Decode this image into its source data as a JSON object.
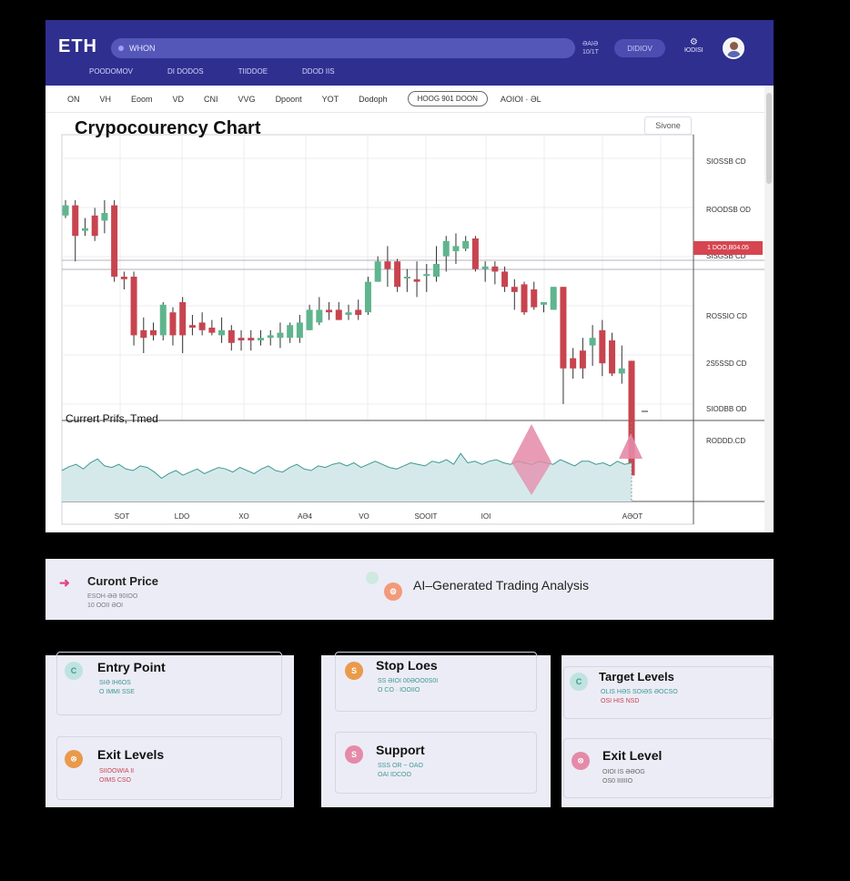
{
  "app": {
    "logo": "ETH",
    "search_text": "WHON",
    "top_meta": [
      "ƏAIƏ",
      "10/1T"
    ],
    "pill_label": "DIDIOV",
    "top_icon_label": "ЮDISI",
    "nav": [
      "POODOMOV",
      "DI DODOS",
      "TIIDDOE",
      "DDOD IIS"
    ]
  },
  "toolbar": {
    "timeframes": [
      "ON",
      "VH",
      "Eoom",
      "VD",
      "CNI",
      "VVG",
      "Dpoont",
      "YOT",
      "Dodoph"
    ],
    "range": "HOOG 901 DOON",
    "range_extra": "AOIOI · ƏL"
  },
  "chart": {
    "title": "Crypocourency Chart",
    "indicator_label": "Currert Prifs, Tmed",
    "legend": "Sivone",
    "price_tag": "1 DOO,B04.05",
    "price_axis": [
      "SIOSSB CD",
      "ROODSB OD",
      "SISGSB CD",
      "ROSSIO CD",
      "2S5SSD CD",
      "SIODBB OD",
      "RODDD.CD"
    ],
    "x_axis": [
      "SOT",
      "LDO",
      "XO",
      "AƏ4",
      "VO",
      "SOOIT",
      "IOI",
      "AƏOT"
    ],
    "colors": {
      "up": "#5fb58e",
      "down": "#c8444f",
      "area": "#d6e9ea",
      "area_line": "#3d9a92",
      "marker": "#e58aa8"
    }
  },
  "chart_data": {
    "type": "candlestick",
    "title": "Crypocourency Chart",
    "xlabel": "",
    "ylabel": "",
    "ylim": [
      0,
      100
    ],
    "candles": [
      {
        "o": 74,
        "c": 78,
        "h": 80,
        "l": 73
      },
      {
        "o": 78,
        "c": 66,
        "h": 80,
        "l": 56
      },
      {
        "o": 68,
        "c": 69,
        "h": 73,
        "l": 66
      },
      {
        "o": 74,
        "c": 66,
        "h": 77,
        "l": 64
      },
      {
        "o": 72,
        "c": 75,
        "h": 80,
        "l": 67
      },
      {
        "o": 78,
        "c": 50,
        "h": 80,
        "l": 48
      },
      {
        "o": 50,
        "c": 49,
        "h": 52,
        "l": 45
      },
      {
        "o": 50,
        "c": 27,
        "h": 52,
        "l": 23
      },
      {
        "o": 29,
        "c": 26,
        "h": 34,
        "l": 20
      },
      {
        "o": 29,
        "c": 27,
        "h": 32,
        "l": 25
      },
      {
        "o": 27,
        "c": 39,
        "h": 40,
        "l": 25
      },
      {
        "o": 36,
        "c": 27,
        "h": 38,
        "l": 23
      },
      {
        "o": 40,
        "c": 27,
        "h": 42,
        "l": 20
      },
      {
        "o": 31,
        "c": 30,
        "h": 35,
        "l": 27
      },
      {
        "o": 32,
        "c": 29,
        "h": 36,
        "l": 27
      },
      {
        "o": 30,
        "c": 28,
        "h": 33,
        "l": 27
      },
      {
        "o": 27,
        "c": 29,
        "h": 34,
        "l": 24
      },
      {
        "o": 29,
        "c": 24,
        "h": 31,
        "l": 21
      },
      {
        "o": 26,
        "c": 25,
        "h": 29,
        "l": 21
      },
      {
        "o": 26,
        "c": 25,
        "h": 29,
        "l": 21
      },
      {
        "o": 25,
        "c": 26,
        "h": 29,
        "l": 23
      },
      {
        "o": 26,
        "c": 27,
        "h": 29,
        "l": 23
      },
      {
        "o": 26,
        "c": 28,
        "h": 32,
        "l": 22
      },
      {
        "o": 26,
        "c": 31,
        "h": 32,
        "l": 24
      },
      {
        "o": 26,
        "c": 32,
        "h": 35,
        "l": 24
      },
      {
        "o": 29,
        "c": 37,
        "h": 39,
        "l": 29
      },
      {
        "o": 32,
        "c": 37,
        "h": 42,
        "l": 31
      },
      {
        "o": 37,
        "c": 36,
        "h": 40,
        "l": 33
      },
      {
        "o": 37,
        "c": 33,
        "h": 40,
        "l": 33
      },
      {
        "o": 35,
        "c": 36,
        "h": 39,
        "l": 33
      },
      {
        "o": 37,
        "c": 35,
        "h": 41,
        "l": 33
      },
      {
        "o": 36,
        "c": 48,
        "h": 50,
        "l": 35
      },
      {
        "o": 48,
        "c": 56,
        "h": 58,
        "l": 48
      },
      {
        "o": 56,
        "c": 53,
        "h": 62,
        "l": 46
      },
      {
        "o": 56,
        "c": 46,
        "h": 57,
        "l": 44
      },
      {
        "o": 50,
        "c": 50,
        "h": 53,
        "l": 44
      },
      {
        "o": 49,
        "c": 48,
        "h": 56,
        "l": 42
      },
      {
        "o": 51,
        "c": 51,
        "h": 55,
        "l": 44
      },
      {
        "o": 50,
        "c": 55,
        "h": 62,
        "l": 48
      },
      {
        "o": 58,
        "c": 64,
        "h": 66,
        "l": 52
      },
      {
        "o": 60,
        "c": 62,
        "h": 67,
        "l": 55
      },
      {
        "o": 61,
        "c": 64,
        "h": 66,
        "l": 60
      },
      {
        "o": 65,
        "c": 53,
        "h": 66,
        "l": 52
      },
      {
        "o": 53,
        "c": 54,
        "h": 56,
        "l": 48
      },
      {
        "o": 54,
        "c": 52,
        "h": 56,
        "l": 47
      },
      {
        "o": 52,
        "c": 46,
        "h": 54,
        "l": 44
      },
      {
        "o": 46,
        "c": 44,
        "h": 49,
        "l": 37
      },
      {
        "o": 47,
        "c": 36,
        "h": 48,
        "l": 35
      },
      {
        "o": 45,
        "c": 38,
        "h": 48,
        "l": 37
      },
      {
        "o": 39,
        "c": 40,
        "h": 40,
        "l": 36
      },
      {
        "o": 37,
        "c": 46,
        "h": 46,
        "l": 37
      },
      {
        "o": 46,
        "c": 14,
        "h": 46,
        "l": 0
      },
      {
        "o": 18,
        "c": 14,
        "h": 22,
        "l": 10
      },
      {
        "o": 21,
        "c": 14,
        "h": 26,
        "l": 10
      },
      {
        "o": 23,
        "c": 26,
        "h": 31,
        "l": 15
      },
      {
        "o": 29,
        "c": 16,
        "h": 33,
        "l": 11
      },
      {
        "o": 25,
        "c": 12,
        "h": 28,
        "l": 11
      },
      {
        "o": 12,
        "c": 14,
        "h": 23,
        "l": 8
      },
      {
        "o": 17,
        "c": -28,
        "h": 17,
        "l": -28
      }
    ],
    "indicator": [
      40,
      45,
      48,
      42,
      50,
      55,
      46,
      44,
      48,
      42,
      40,
      46,
      44,
      38,
      30,
      36,
      40,
      34,
      38,
      42,
      36,
      40,
      44,
      42,
      38,
      44,
      40,
      36,
      42,
      46,
      40,
      38,
      44,
      48,
      42,
      40,
      46,
      44,
      48,
      50,
      46,
      50,
      44,
      48,
      52,
      48,
      44,
      42,
      46,
      50,
      48,
      46,
      52,
      50,
      54,
      48,
      62,
      50,
      52,
      48,
      52,
      54,
      50,
      48,
      52,
      50,
      48,
      52,
      50,
      48,
      54,
      50,
      46,
      52,
      52,
      48,
      50,
      46,
      52,
      48,
      50
    ]
  },
  "analysis": {
    "current_price_title": "Curont Price",
    "current_price_values": [
      "ESOH·ƏƏ 90IOO",
      "10 OOII ƏOI"
    ],
    "ai_title": "AI–Generated Trading Analysis"
  },
  "cards": {
    "entry": {
      "title": "Entry Point",
      "lines": [
        "SIƏ IH6OS",
        "O IMMI SSE"
      ],
      "icon": "C"
    },
    "exit_levels": {
      "title": "Exit Levels",
      "lines": [
        "SIIOOWIA II",
        "OIMS CSO"
      ],
      "icon": "ꕕ"
    },
    "stop_loss": {
      "title": "Stop Loes",
      "lines": [
        "SS ƏIOI 00ƏOO0S0I",
        "O CO · IOOIIO"
      ],
      "icon": "S"
    },
    "support": {
      "title": "Support",
      "lines": [
        "SSS OR ~ OAO",
        "OAI IDCOO"
      ],
      "icon": "S"
    },
    "target": {
      "title": "Target Levels",
      "lines": [
        "OLIS HƏS SOIƏS ƏOCSO",
        "OSI HIS NSD"
      ],
      "icon": "C"
    },
    "exit_level": {
      "title": "Exit Level",
      "lines": [
        "OIOI IS ƏƏOG",
        "OS0 IIIIIIO"
      ],
      "icon": "ꕕ"
    }
  }
}
